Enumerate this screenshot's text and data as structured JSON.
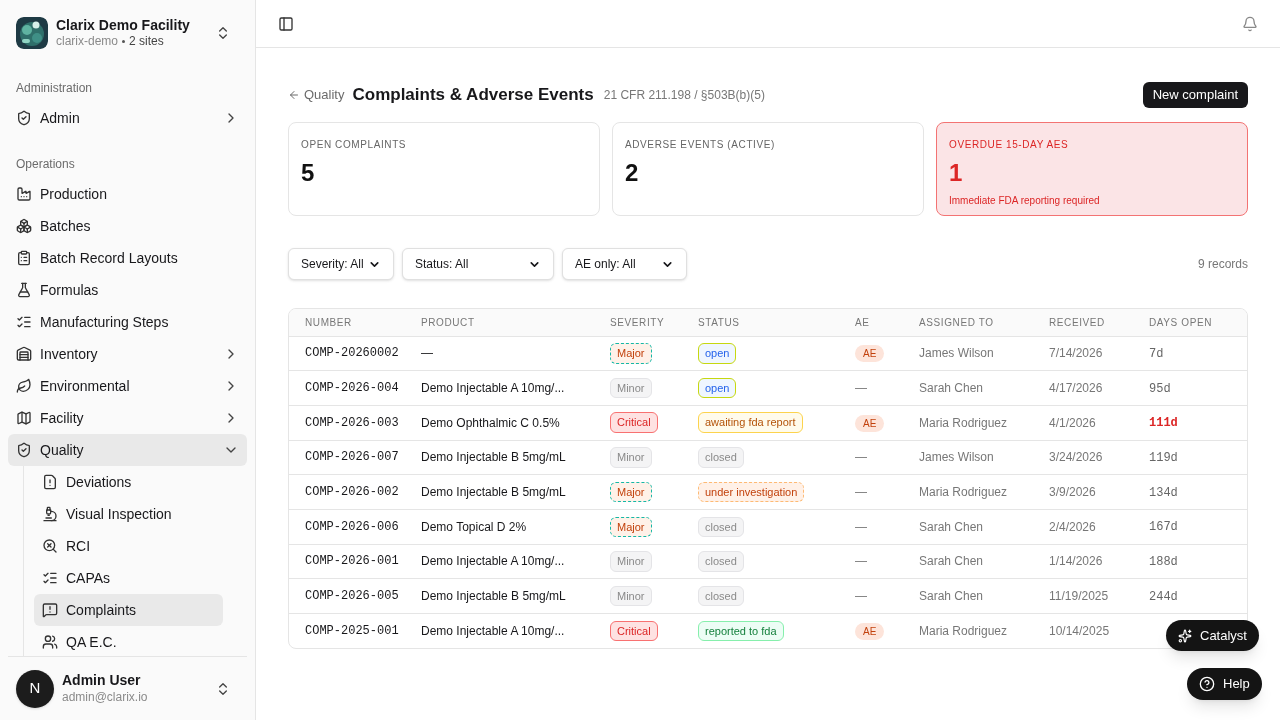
{
  "org": {
    "name": "Clarix Demo Facility",
    "slug": "clarix-demo",
    "sites": "2 sites"
  },
  "sidebar": {
    "sections": [
      {
        "title": "Administration",
        "items": [
          {
            "label": "Admin",
            "selected": false,
            "expanded": false
          }
        ]
      },
      {
        "title": "Operations",
        "items": [
          {
            "label": "Production",
            "selected": false
          },
          {
            "label": "Batches",
            "selected": false
          },
          {
            "label": "Batch Record Layouts",
            "selected": false
          },
          {
            "label": "Formulas",
            "selected": false
          },
          {
            "label": "Manufacturing Steps",
            "selected": false
          },
          {
            "label": "Inventory",
            "selected": false,
            "expanded": false
          },
          {
            "label": "Environmental",
            "selected": false,
            "expanded": false
          },
          {
            "label": "Facility",
            "selected": false,
            "expanded": false
          },
          {
            "label": "Quality",
            "selected": true,
            "expanded": true,
            "children": [
              {
                "label": "Deviations",
                "selected": false
              },
              {
                "label": "Visual Inspection",
                "selected": false
              },
              {
                "label": "RCI",
                "selected": false
              },
              {
                "label": "CAPAs",
                "selected": false
              },
              {
                "label": "Complaints",
                "selected": true
              },
              {
                "label": "QA E.C.",
                "selected": false
              }
            ]
          }
        ]
      }
    ]
  },
  "user": {
    "initial": "N",
    "name": "Admin User",
    "email": "admin@clarix.io"
  },
  "page": {
    "back": "Quality",
    "title": "Complaints & Adverse Events",
    "reference": "21 CFR 211.198 / §503B(b)(5)",
    "action": "New complaint"
  },
  "stats": [
    {
      "label": "OPEN COMPLAINTS",
      "value": "5",
      "alert": false
    },
    {
      "label": "ADVERSE EVENTS (ACTIVE)",
      "value": "2",
      "alert": false
    },
    {
      "label": "OVERDUE 15-DAY AES",
      "value": "1",
      "alert": true,
      "note": "Immediate FDA reporting required"
    }
  ],
  "filters": [
    "Severity: All",
    "Status: All",
    "AE only: All"
  ],
  "record_count": "9 records",
  "table": {
    "columns": [
      "NUMBER",
      "PRODUCT",
      "SEVERITY",
      "STATUS",
      "AE",
      "ASSIGNED TO",
      "RECEIVED",
      "DAYS OPEN"
    ],
    "rows": [
      {
        "number": "COMP-20260002",
        "product": "—",
        "severity": {
          "label": "Major",
          "kind": "major"
        },
        "status": {
          "label": "open",
          "kind": "open"
        },
        "ae": "AE",
        "ae_flag": true,
        "assigned": "James Wilson",
        "received": "7/14/2026",
        "days": "7d",
        "overdue": false
      },
      {
        "number": "COMP-2026-004",
        "product": "Demo Injectable A 10mg/...",
        "severity": {
          "label": "Minor",
          "kind": "minor"
        },
        "status": {
          "label": "open",
          "kind": "open"
        },
        "ae": "—",
        "ae_flag": false,
        "assigned": "Sarah Chen",
        "received": "4/17/2026",
        "days": "95d",
        "overdue": false
      },
      {
        "number": "COMP-2026-003",
        "product": "Demo Ophthalmic C 0.5%",
        "severity": {
          "label": "Critical",
          "kind": "critical"
        },
        "status": {
          "label": "awaiting fda report",
          "kind": "awaiting"
        },
        "ae": "AE",
        "ae_flag": true,
        "assigned": "Maria Rodriguez",
        "received": "4/1/2026",
        "days": "111d",
        "overdue": true
      },
      {
        "number": "COMP-2026-007",
        "product": "Demo Injectable B 5mg/mL",
        "severity": {
          "label": "Minor",
          "kind": "minor"
        },
        "status": {
          "label": "closed",
          "kind": "closed"
        },
        "ae": "—",
        "ae_flag": false,
        "assigned": "James Wilson",
        "received": "3/24/2026",
        "days": "119d",
        "overdue": false
      },
      {
        "number": "COMP-2026-002",
        "product": "Demo Injectable B 5mg/mL",
        "severity": {
          "label": "Major",
          "kind": "major"
        },
        "status": {
          "label": "under investigation",
          "kind": "investigation"
        },
        "ae": "—",
        "ae_flag": false,
        "assigned": "Maria Rodriguez",
        "received": "3/9/2026",
        "days": "134d",
        "overdue": false
      },
      {
        "number": "COMP-2026-006",
        "product": "Demo Topical D 2%",
        "severity": {
          "label": "Major",
          "kind": "major"
        },
        "status": {
          "label": "closed",
          "kind": "closed"
        },
        "ae": "—",
        "ae_flag": false,
        "assigned": "Sarah Chen",
        "received": "2/4/2026",
        "days": "167d",
        "overdue": false
      },
      {
        "number": "COMP-2026-001",
        "product": "Demo Injectable A 10mg/...",
        "severity": {
          "label": "Minor",
          "kind": "minor"
        },
        "status": {
          "label": "closed",
          "kind": "closed"
        },
        "ae": "—",
        "ae_flag": false,
        "assigned": "Sarah Chen",
        "received": "1/14/2026",
        "days": "188d",
        "overdue": false
      },
      {
        "number": "COMP-2026-005",
        "product": "Demo Injectable B 5mg/mL",
        "severity": {
          "label": "Minor",
          "kind": "minor"
        },
        "status": {
          "label": "closed",
          "kind": "closed"
        },
        "ae": "—",
        "ae_flag": false,
        "assigned": "Sarah Chen",
        "received": "11/19/2025",
        "days": "244d",
        "overdue": false
      },
      {
        "number": "COMP-2025-001",
        "product": "Demo Injectable A 10mg/...",
        "severity": {
          "label": "Critical",
          "kind": "critical"
        },
        "status": {
          "label": "reported to fda",
          "kind": "reported"
        },
        "ae": "AE",
        "ae_flag": true,
        "assigned": "Maria Rodriguez",
        "received": "10/14/2025"
      }
    ]
  },
  "floating": {
    "assistant": "Catalyst",
    "help": "Help"
  }
}
